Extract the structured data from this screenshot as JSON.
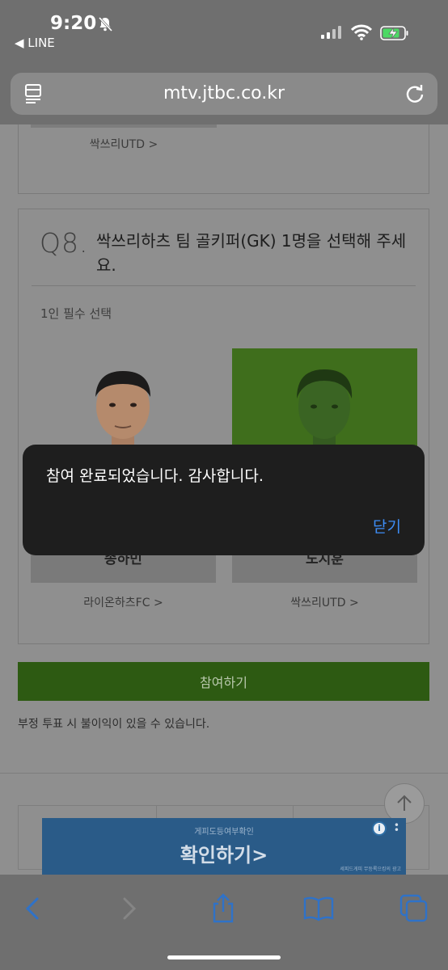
{
  "status_bar": {
    "time": "9:20",
    "back_app": "◀ LINE"
  },
  "browser": {
    "url": "mtv.jtbc.co.kr"
  },
  "previous_card": {
    "team_link": "싹쓰리UTD >"
  },
  "question": {
    "number": "Q8.",
    "text": "싹쓰리하츠 팀 골키퍼(GK) 1명을 선택해 주세요.",
    "requirement": "1인 필수 선택",
    "candidates": [
      {
        "name": "송하민",
        "team": "라이온하츠FC >",
        "selected": false
      },
      {
        "name": "도지훈",
        "team": "싹쓰리UTD >",
        "selected": true
      }
    ]
  },
  "vote_button": "참여하기",
  "warning": "부정 투표 시 불이익이 있을 수 있습니다.",
  "ad": {
    "small_text": "게피도등여부확인",
    "headline": "확인하기>",
    "fine_print": "세피드게피 무등록으킹의 광고"
  },
  "alert": {
    "message": "참여 완료되었습니다. 감사합니다.",
    "close_label": "닫기"
  },
  "colors": {
    "accent_green": "#4fa21f",
    "ios_blue": "#3d8df6",
    "alert_bg": "#1e1e1e"
  }
}
